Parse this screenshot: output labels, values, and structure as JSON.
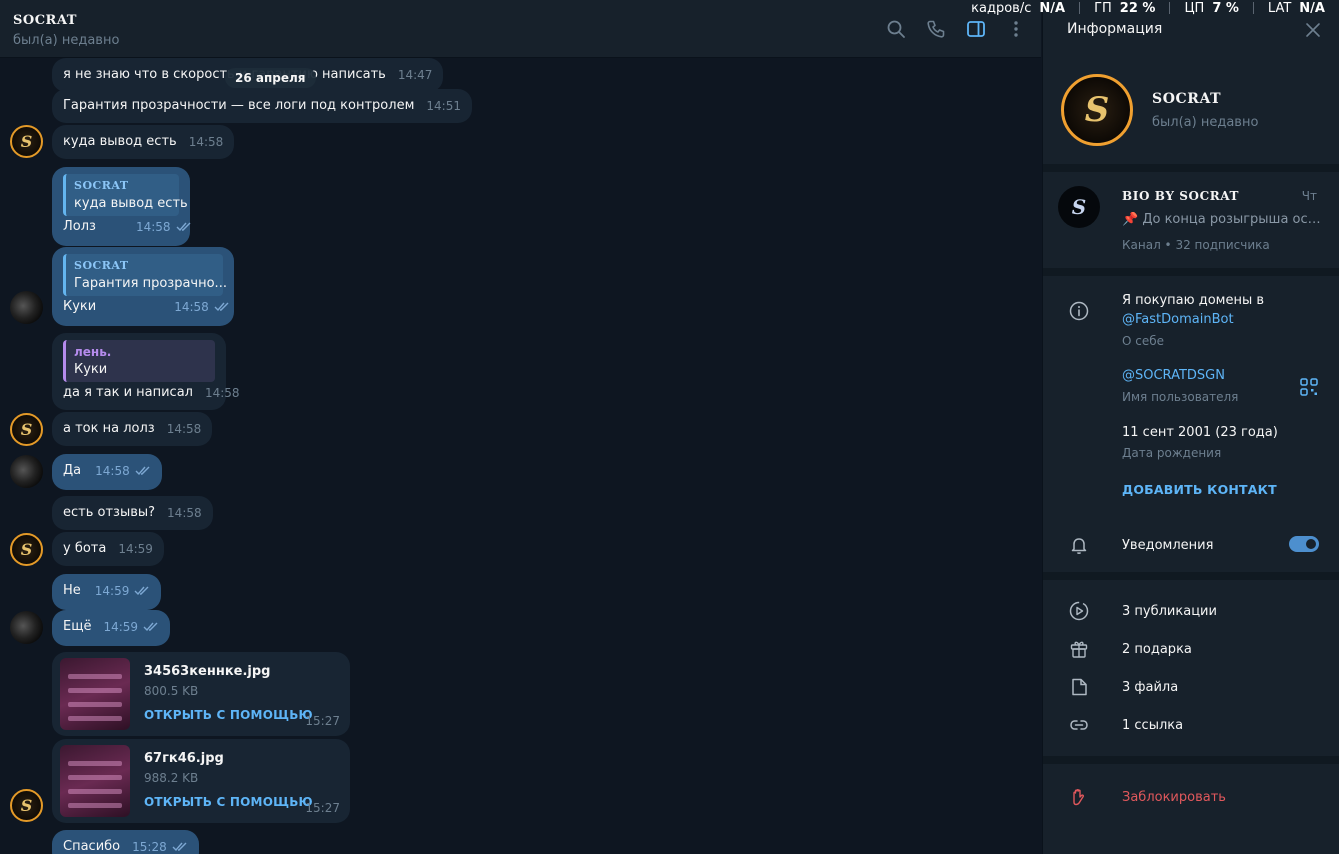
{
  "overlay": {
    "fps_label": "кадров/с",
    "fps_value": "N/A",
    "gpu_label": "ГП",
    "gpu_value": "22 %",
    "cpu_label": "ЦП",
    "cpu_value": "7 %",
    "lat_label": "LAT",
    "lat_value": "N/A"
  },
  "header": {
    "title": "SOCRAT",
    "status": "был(а) недавно"
  },
  "chat": {
    "date": "26 апреля",
    "m1": {
      "text": "я не знаю что в скорость и гарантию написать",
      "time": "14:47"
    },
    "m2": {
      "text": "Гарантия прозрачности — все логи под контролем",
      "time": "14:51"
    },
    "m3": {
      "text": "куда вывод есть",
      "time": "14:58"
    },
    "m4": {
      "reply_name": "SOCRAT",
      "reply_text": "куда вывод есть",
      "text": "Лолз",
      "time": "14:58"
    },
    "m5": {
      "reply_name": "SOCRAT",
      "reply_text": "Гарантия прозрачно...",
      "text": "Куки",
      "time": "14:58"
    },
    "m6": {
      "reply_name": "лень.",
      "reply_text": "Куки",
      "text": "да я так и написал",
      "time": "14:58"
    },
    "m7": {
      "text": "а ток на лолз",
      "time": "14:58"
    },
    "m8": {
      "text": "Да",
      "time": "14:58"
    },
    "m9": {
      "text": "есть отзывы?",
      "time": "14:58"
    },
    "m10": {
      "text": "у бота",
      "time": "14:59"
    },
    "m11": {
      "text": "Не",
      "time": "14:59"
    },
    "m12": {
      "text": "Ещё",
      "time": "14:59"
    },
    "f1": {
      "name": "34563кеннке.jpg",
      "size": "800.5 KB",
      "action": "ОТКРЫТЬ С ПОМОЩЬЮ",
      "time": "15:27"
    },
    "f2": {
      "name": "67гк46.jpg",
      "size": "988.2 KB",
      "action": "ОТКРЫТЬ С ПОМОЩЬЮ",
      "time": "15:27"
    },
    "m13": {
      "text": "Спасибо",
      "time": "15:28"
    }
  },
  "panel": {
    "title": "Информация",
    "name": "SOCRAT",
    "status": "был(а) недавно",
    "channel": {
      "name": "BIO BY SOCRAT",
      "day": "Чт",
      "pinned": "До конца розыгрыша оста...",
      "sub": "Канал • 32 подписчика"
    },
    "bio_line1": "Я покупаю домены в",
    "bio_link": "@FastDomainBot",
    "bio_label": "О себе",
    "username": "@SOCRATDSGN",
    "username_label": "Имя пользователя",
    "birthday": "11 сент 2001 (23 года)",
    "birthday_label": "Дата рождения",
    "add_contact": "ДОБАВИТЬ КОНТАКТ",
    "notifications": "Уведомления",
    "posts": "3 публикации",
    "gifts": "2 подарка",
    "files": "3 файла",
    "links": "1 ссылка",
    "block": "Заблокировать"
  },
  "colors": {
    "bg": "#0e1621",
    "panel": "#17212b",
    "incoming": "#182533",
    "outgoing": "#2b5278",
    "accent": "#5eb5f7",
    "danger": "#e0585c"
  }
}
